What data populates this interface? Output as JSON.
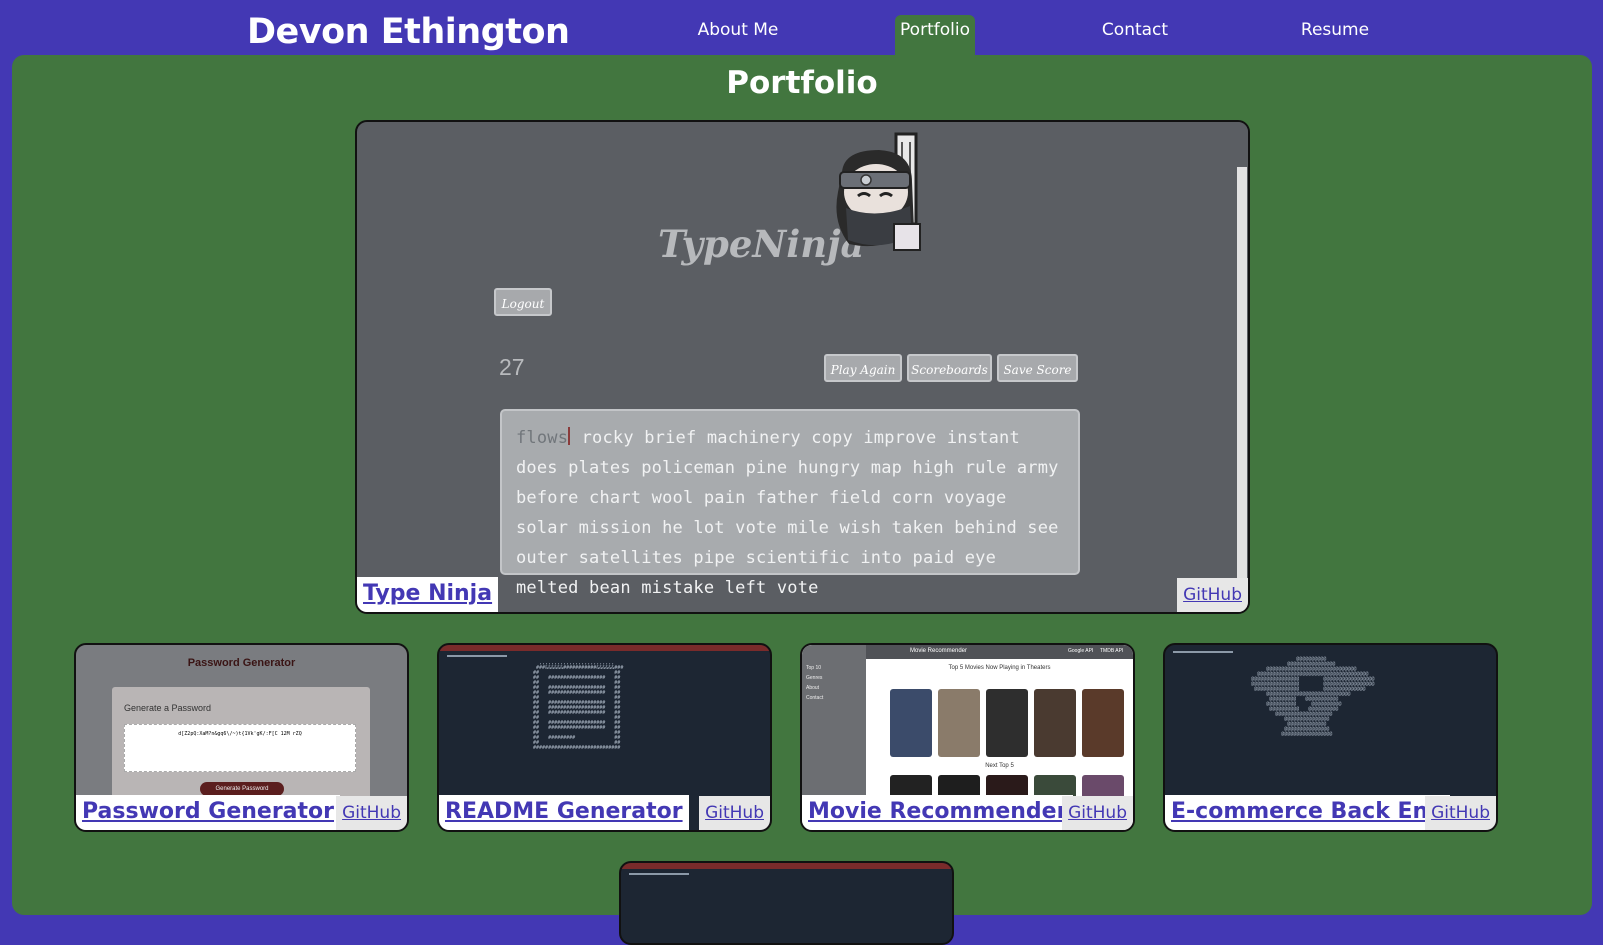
{
  "header": {
    "site_name": "Devon Ethington",
    "nav": [
      "About Me",
      "Portfolio",
      "Contact",
      "Resume"
    ],
    "active_nav": "Portfolio"
  },
  "main": {
    "title": "Portfolio",
    "featured": {
      "app_title": "TypeNinja",
      "logout_label": "Logout",
      "score": "27",
      "buttons": [
        "Play Again",
        "Scoreboards",
        "Save Score"
      ],
      "typed_text": "flow",
      "current_char": "s",
      "remaining_text": " rocky brief machinery copy improve instant does plates policeman pine hungry map high rule army before chart wool pain father field corn voyage solar mission he lot vote mile wish taken behind see outer satellites pipe scientific into paid eye melted bean mistake left vote",
      "label": "Type Ninja",
      "github_label": "GitHub"
    },
    "projects": [
      {
        "label": "Password Generator",
        "github_label": "GitHub",
        "preview_title": "Password Generator",
        "preview_subtitle": "Generate a Password",
        "preview_password": "d[Z2pQ:XaM?n&gq6\\/~)t{1Vk'gK/:F[C 12M rZQ",
        "preview_button": "Generate Password"
      },
      {
        "label": "README Generator",
        "github_label": "GitHub"
      },
      {
        "label": "Movie Recommender",
        "github_label": "GitHub",
        "preview_header": "Movie Recommender",
        "preview_links": [
          "Google API",
          "TMDB API"
        ],
        "preview_heading": "Top 5 Movies Now Playing in Theaters",
        "preview_subheading": "Next Top 5",
        "preview_sidebar": [
          "Top 10",
          "Genres",
          "About",
          "Contact"
        ]
      },
      {
        "label": "E-commerce Back End",
        "github_label": "GitHub"
      }
    ]
  },
  "colors": {
    "brand": "#4338b4",
    "panel": "#42763f",
    "card_bg": "#5b5e63"
  }
}
